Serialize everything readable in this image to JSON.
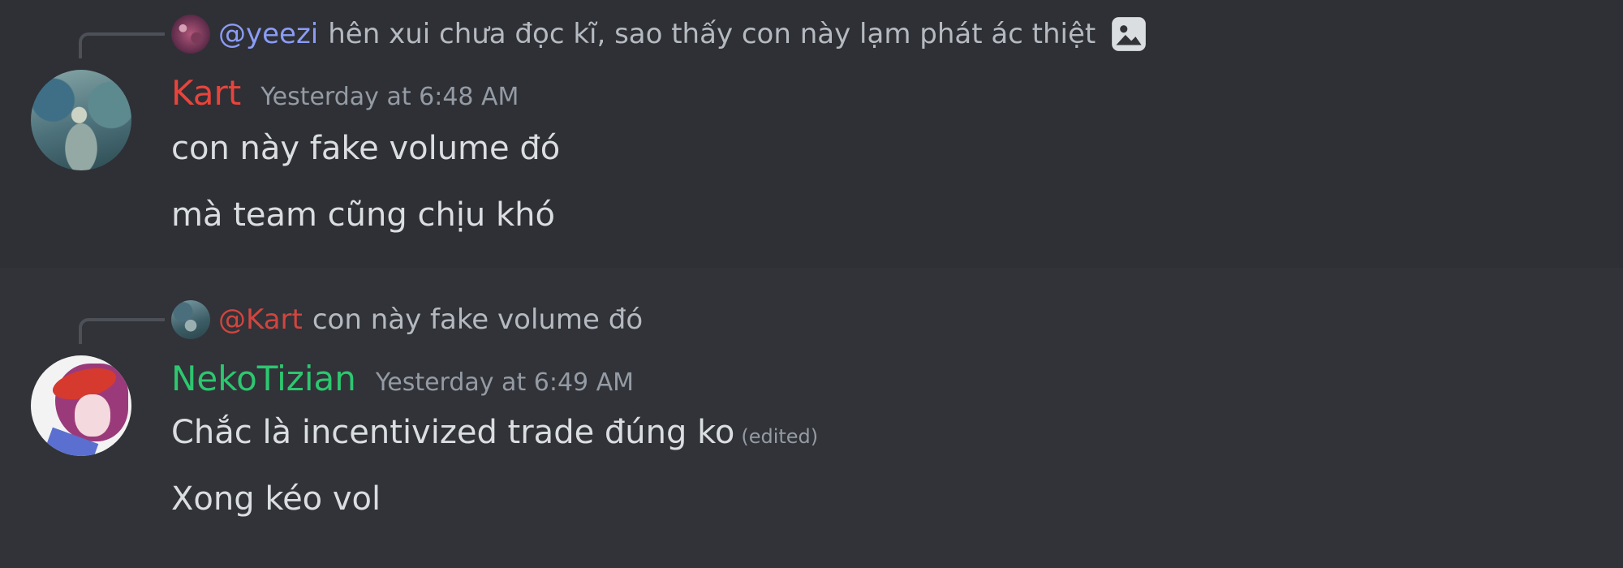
{
  "messages": [
    {
      "reply": {
        "mention": "@yeezi",
        "text": "hên xui chưa đọc kĩ, sao thấy con này lạm phát ác thiệt",
        "has_image_attachment": true
      },
      "author": "Kart",
      "author_color": "#e8443c",
      "timestamp": "Yesterday at 6:48 AM",
      "lines": [
        "con này fake volume đó",
        "mà team cũng chịu khó"
      ]
    },
    {
      "reply": {
        "mention": "@Kart",
        "text": "con này fake volume đó",
        "has_image_attachment": false
      },
      "author": "NekoTizian",
      "author_color": "#2dc770",
      "timestamp": "Yesterday at 6:49 AM",
      "lines": [
        "Chắc là incentivized trade đúng ko",
        "Xong kéo vol"
      ],
      "edited_label": "(edited)"
    }
  ],
  "icons": {
    "reply_attachment": "image-icon"
  }
}
